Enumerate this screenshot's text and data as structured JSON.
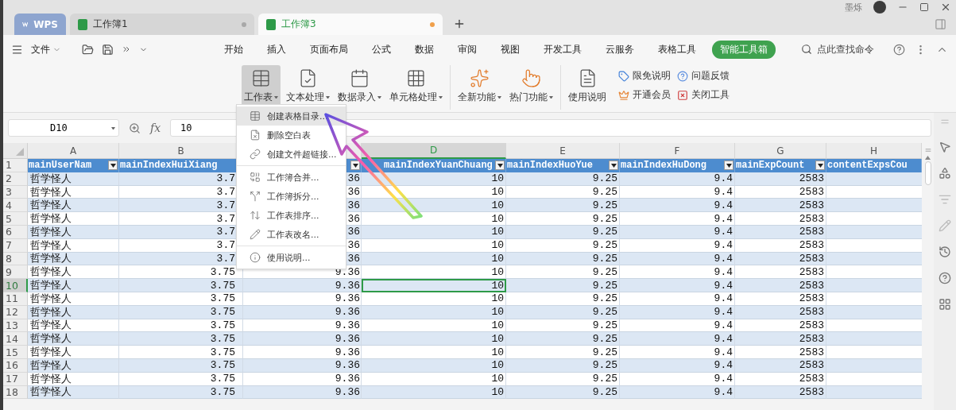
{
  "tabs": [
    {
      "label": "WPS",
      "kind": "home",
      "selected": false
    },
    {
      "label": "工作簿1",
      "kind": "doc",
      "selected": false,
      "modified": false
    },
    {
      "label": "工作簿3",
      "kind": "doc",
      "selected": true,
      "modified": true
    }
  ],
  "user": {
    "name": "墨烁"
  },
  "menu": {
    "file": "文件",
    "tabs": [
      {
        "label": "开始",
        "selected": false
      },
      {
        "label": "插入",
        "selected": false
      },
      {
        "label": "页面布局",
        "selected": false
      },
      {
        "label": "公式",
        "selected": false
      },
      {
        "label": "数据",
        "selected": false
      },
      {
        "label": "审阅",
        "selected": false
      },
      {
        "label": "视图",
        "selected": false
      },
      {
        "label": "开发工具",
        "selected": false
      },
      {
        "label": "云服务",
        "selected": false
      },
      {
        "label": "表格工具",
        "selected": false
      },
      {
        "label": "智能工具箱",
        "selected": true
      }
    ]
  },
  "search": {
    "placeholder": "点此查找命令"
  },
  "ribbon": {
    "groups": [
      {
        "items": [
          {
            "kind": "large",
            "label": "工作表",
            "dropdown": true,
            "selected": true
          },
          {
            "kind": "large",
            "label": "文本处理",
            "dropdown": true,
            "selected": false
          },
          {
            "kind": "large",
            "label": "数据录入",
            "dropdown": true,
            "selected": false
          },
          {
            "kind": "large",
            "label": "单元格处理",
            "dropdown": true,
            "selected": false
          }
        ]
      },
      {
        "items": [
          {
            "kind": "large",
            "label": "全新功能",
            "dropdown": true,
            "selected": false
          },
          {
            "kind": "large",
            "label": "热门功能",
            "dropdown": true,
            "selected": false
          }
        ]
      },
      {
        "items": [
          {
            "kind": "large",
            "label": "使用说明",
            "dropdown": false,
            "selected": false
          }
        ]
      },
      {
        "items": [
          {
            "kind": "small",
            "label": "限免说明"
          },
          {
            "kind": "small",
            "label": "问题反馈"
          },
          {
            "kind": "small",
            "label": "开通会员"
          },
          {
            "kind": "small",
            "label": "关闭工具"
          }
        ]
      }
    ]
  },
  "formula_bar": {
    "cell": "D10",
    "fx": "fx",
    "value": "10"
  },
  "table": {
    "columns": [
      {
        "label": "A",
        "selected": false
      },
      {
        "label": "B",
        "selected": false
      },
      {
        "selected": false
      },
      {
        "label": "D",
        "selected": true
      },
      {
        "label": "E",
        "selected": false
      },
      {
        "label": "F",
        "selected": false
      },
      {
        "label": "G",
        "selected": false
      },
      {
        "label": "H",
        "selected": false
      }
    ],
    "header_row": {
      "number": "1",
      "cells": [
        {
          "text": "mainUserNam",
          "filter": true
        },
        {
          "text": "mainIndexHuiXiang",
          "filter": false
        },
        {
          "filter": true
        },
        {
          "text": "mainIndexYuanChuang",
          "filter": true
        },
        {
          "text": "mainIndexHuoYue",
          "filter": true
        },
        {
          "text": "mainIndexHuDong",
          "filter": true
        },
        {
          "text": "mainExpCount",
          "filter": true
        },
        {
          "text": "contentExpsCou",
          "filter": false
        }
      ]
    },
    "rows": [
      {
        "number": "2",
        "selected": false,
        "cells": [
          "哲学怪人",
          "3.7",
          "36",
          "10",
          "9.25",
          "9.4",
          "2583"
        ]
      },
      {
        "number": "3",
        "selected": false,
        "cells": [
          "哲学怪人",
          "3.7",
          "36",
          "10",
          "9.25",
          "9.4",
          "2583"
        ]
      },
      {
        "number": "4",
        "selected": false,
        "cells": [
          "哲学怪人",
          "3.7",
          "36",
          "10",
          "9.25",
          "9.4",
          "2583"
        ]
      },
      {
        "number": "5",
        "selected": false,
        "cells": [
          "哲学怪人",
          "3.7",
          "36",
          "10",
          "9.25",
          "9.4",
          "2583"
        ]
      },
      {
        "number": "6",
        "selected": false,
        "cells": [
          "哲学怪人",
          "3.7",
          "36",
          "10",
          "9.25",
          "9.4",
          "2583"
        ]
      },
      {
        "number": "7",
        "selected": false,
        "cells": [
          "哲学怪人",
          "3.7",
          "36",
          "10",
          "9.25",
          "9.4",
          "2583"
        ]
      },
      {
        "number": "8",
        "selected": false,
        "cells": [
          "哲学怪人",
          "3.7",
          "36",
          "10",
          "9.25",
          "9.4",
          "2583"
        ]
      },
      {
        "number": "9",
        "selected": false,
        "cells": [
          "哲学怪人",
          "3.75",
          "9.36",
          "10",
          "9.25",
          "9.4",
          "2583"
        ]
      },
      {
        "number": "10",
        "selected": true,
        "cells": [
          "哲学怪人",
          "3.75",
          "9.36",
          "10",
          "9.25",
          "9.4",
          "2583"
        ]
      },
      {
        "number": "11",
        "selected": false,
        "cells": [
          "哲学怪人",
          "3.75",
          "9.36",
          "10",
          "9.25",
          "9.4",
          "2583"
        ]
      },
      {
        "number": "12",
        "selected": false,
        "cells": [
          "哲学怪人",
          "3.75",
          "9.36",
          "10",
          "9.25",
          "9.4",
          "2583"
        ]
      },
      {
        "number": "13",
        "selected": false,
        "cells": [
          "哲学怪人",
          "3.75",
          "9.36",
          "10",
          "9.25",
          "9.4",
          "2583"
        ]
      },
      {
        "number": "14",
        "selected": false,
        "cells": [
          "哲学怪人",
          "3.75",
          "9.36",
          "10",
          "9.25",
          "9.4",
          "2583"
        ]
      },
      {
        "number": "15",
        "selected": false,
        "cells": [
          "哲学怪人",
          "3.75",
          "9.36",
          "10",
          "9.25",
          "9.4",
          "2583"
        ]
      },
      {
        "number": "16",
        "selected": false,
        "cells": [
          "哲学怪人",
          "3.75",
          "9.36",
          "10",
          "9.25",
          "9.4",
          "2583"
        ]
      },
      {
        "number": "17",
        "selected": false,
        "cells": [
          "哲学怪人",
          "3.75",
          "9.36",
          "10",
          "9.25",
          "9.4",
          "2583"
        ]
      },
      {
        "number": "18",
        "selected": false,
        "cells": [
          "哲学怪人",
          "3.75",
          "9.36",
          "10",
          "9.25",
          "9.4",
          "2583"
        ]
      }
    ]
  },
  "dropdown": {
    "groups": [
      [
        {
          "label": "创建表格目录...",
          "highlighted": true
        },
        {
          "label": "删除空白表",
          "highlighted": false
        },
        {
          "label": "创建文件超链接...",
          "highlighted": false
        }
      ],
      [
        {
          "label": "工作簿合并...",
          "highlighted": false
        },
        {
          "label": "工作簿拆分...",
          "highlighted": false
        },
        {
          "label": "工作表排序...",
          "highlighted": false
        },
        {
          "label": "工作表改名...",
          "highlighted": false
        }
      ],
      [
        {
          "label": "使用说明...",
          "highlighted": false
        }
      ]
    ]
  }
}
